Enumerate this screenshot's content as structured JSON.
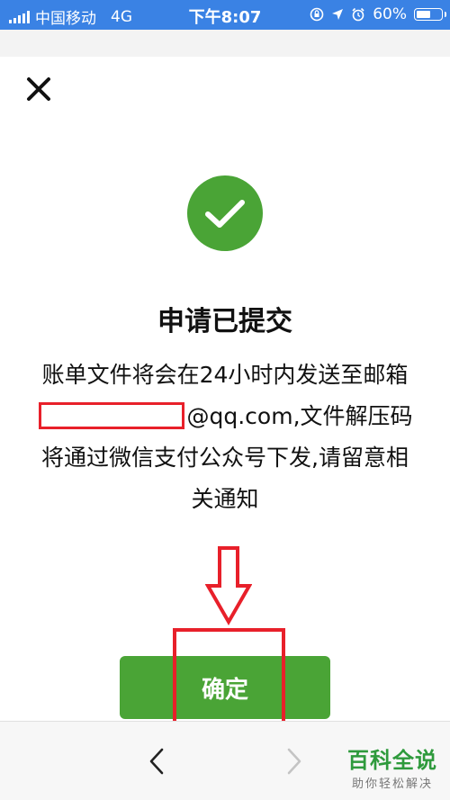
{
  "status_bar": {
    "carrier": "中国移动",
    "network": "4G",
    "time": "下午8:07",
    "battery_percent": "60%",
    "battery_level": 0.6
  },
  "dialog": {
    "title": "申请已提交",
    "message_part1": "账单文件将会在24小时内发送至邮箱",
    "message_part2": "@qq.com,文件解压码将通过微信支付公众号下发,请留意相关通知",
    "confirm_label": "确定"
  },
  "watermark": {
    "title": "百科全说",
    "subtitle": "助你轻松解决"
  },
  "colors": {
    "status_bar": "#3a82e4",
    "success_green": "#4aa436",
    "annotation_red": "#e8202a"
  },
  "icons": {
    "close": "close-icon",
    "success": "checkmark-circle-icon",
    "back": "chevron-left-icon",
    "forward": "chevron-right-icon"
  }
}
